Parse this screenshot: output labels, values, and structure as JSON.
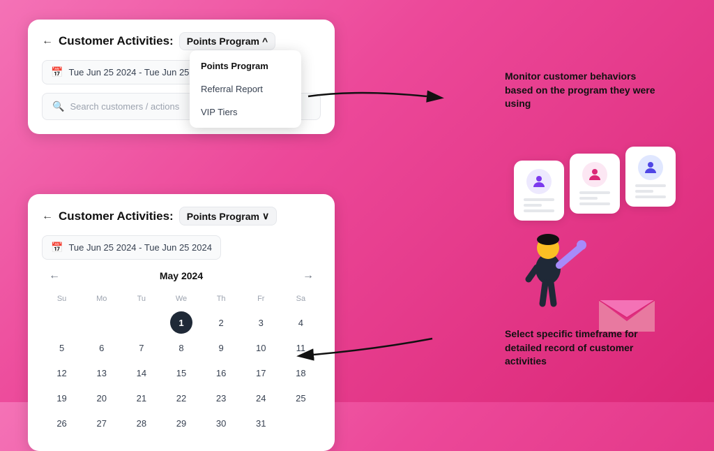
{
  "page": {
    "background": "pink-gradient"
  },
  "top_card": {
    "back_arrow": "←",
    "title": "Customer Activities:",
    "program_label": "Points Program",
    "program_arrow": "^",
    "date_range": "Tue Jun 25 2024 - Tue Jun 25 2024",
    "search_placeholder": "Search customers / actions"
  },
  "dropdown": {
    "items": [
      {
        "label": "Points Program",
        "active": true
      },
      {
        "label": "Referral Report",
        "active": false
      },
      {
        "label": "VIP Tiers",
        "active": false
      }
    ]
  },
  "annotation_top": {
    "text": "Monitor customer behaviors based on the program they were using"
  },
  "bottom_card": {
    "back_arrow": "←",
    "title": "Customer Activities:",
    "program_label": "Points Program",
    "program_arrow": "∨",
    "date_range": "Tue Jun 25 2024 - Tue Jun 25 2024"
  },
  "calendar": {
    "month": "May 2024",
    "day_headers": [
      "Su",
      "Mo",
      "Tu",
      "We",
      "Th",
      "Fr",
      "Sa"
    ],
    "weeks": [
      [
        "",
        "",
        "",
        "1",
        "2",
        "3",
        "4"
      ],
      [
        "5",
        "6",
        "7",
        "8",
        "9",
        "10",
        "11"
      ],
      [
        "12",
        "13",
        "14",
        "15",
        "16",
        "17",
        "18"
      ],
      [
        "19",
        "20",
        "21",
        "22",
        "23",
        "24",
        "25"
      ],
      [
        "26",
        "27",
        "28",
        "29",
        "30",
        "31",
        ""
      ]
    ],
    "selected_day": "1"
  },
  "annotation_bottom": {
    "text": "Select specific timeframe for detailed record of customer activities"
  },
  "illustration": {
    "cards": [
      {
        "avatar_color": "#a78bfa"
      },
      {
        "avatar_color": "#f472b6"
      },
      {
        "avatar_color": "#818cf8"
      }
    ]
  }
}
